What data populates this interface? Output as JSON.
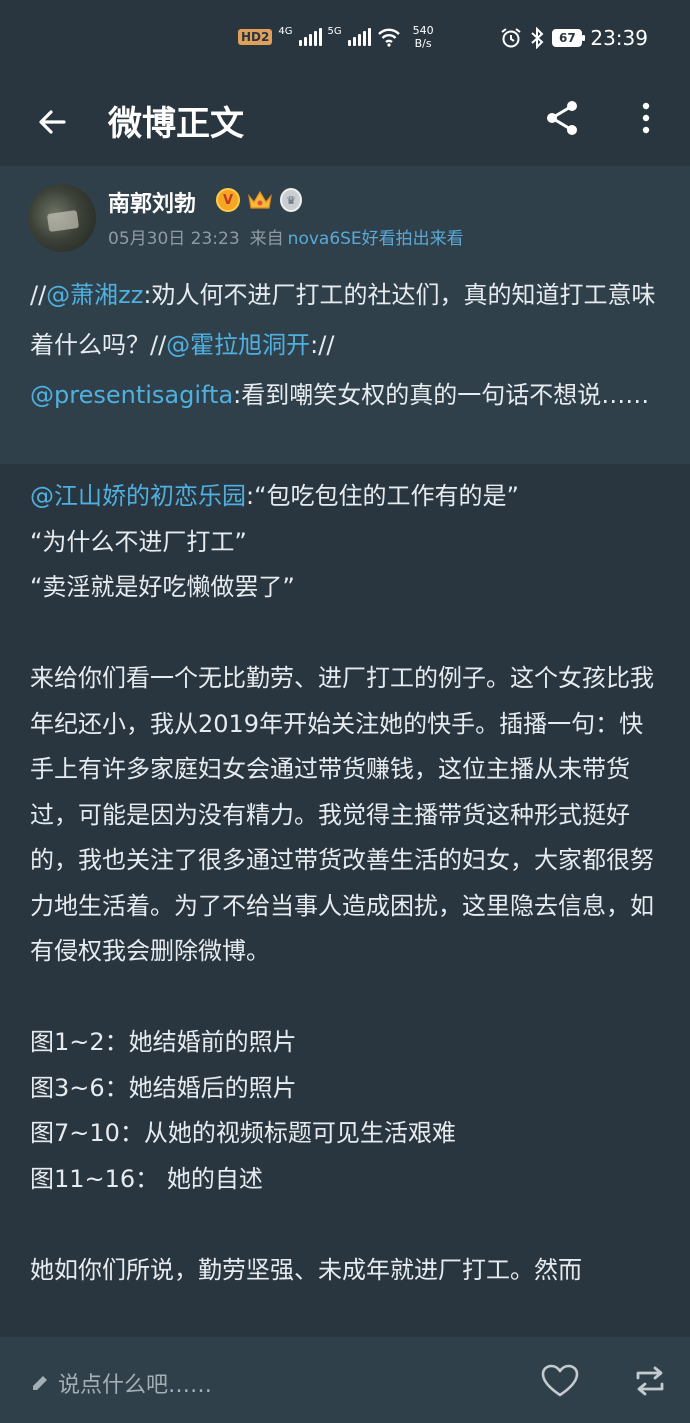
{
  "status_bar": {
    "hd_label": "HD",
    "hd_sub": "2",
    "net1": "4G",
    "net2": "5G",
    "speed_value": "540",
    "speed_unit": "B/s",
    "battery": "67",
    "time": "23:39"
  },
  "header": {
    "title": "微博正文"
  },
  "post": {
    "author": "南郭刘勃",
    "verified_mark": "V",
    "date": "05月30日 23:23",
    "source_prefix": "来自",
    "source": "nova6SE好看拍出来看",
    "repost_chain": {
      "p1": "//",
      "m1": "@萧湘zz",
      "t1": ":劝人何不进厂打工的社达们，真的知道打工意味着什么吗？//",
      "m2": "@霍拉旭洞开",
      "t2": "://",
      "m3": "@presentisagifta",
      "t3": ":看到嘲笑女权的真的一句话不想说……"
    },
    "body": {
      "m4": "@江山娇的初恋乐园",
      "q1": ":“包吃包住的工作有的是”",
      "q2": "“为什么不进厂打工”",
      "q3": "“卖淫就是好吃懒做罢了”",
      "para1": "来给你们看一个无比勤劳、进厂打工的例子。这个女孩比我年纪还小，我从2019年开始关注她的快手。插播一句：快手上有许多家庭妇女会通过带货赚钱，这位主播从未带货过，可能是因为没有精力。我觉得主播带货这种形式挺好的，我也关注了很多通过带货改善生活的妇女，大家都很努力地生活着。为了不给当事人造成困扰，这里隐去信息，如有侵权我会删除微博。",
      "list1": "图1~2：她结婚前的照片",
      "list2": "图3~6：她结婚后的照片",
      "list3": "图7~10：从她的视频标题可见生活艰难",
      "list4": "图11~16： 她的自述",
      "para2": "她如你们所说，勤劳坚强、未成年就进厂打工。然而"
    }
  },
  "bottom_bar": {
    "comment_placeholder": "说点什么吧……"
  },
  "colors": {
    "background": "#2a363f",
    "card": "#30404a",
    "link": "#4fb0e0",
    "text": "#e6ebef",
    "meta": "#8f9ba4"
  },
  "icons": {
    "back": "arrow-left-icon",
    "share": "share-icon",
    "more": "more-vertical-icon",
    "edit": "pencil-icon",
    "like": "heart-icon",
    "repost": "repost-icon"
  }
}
